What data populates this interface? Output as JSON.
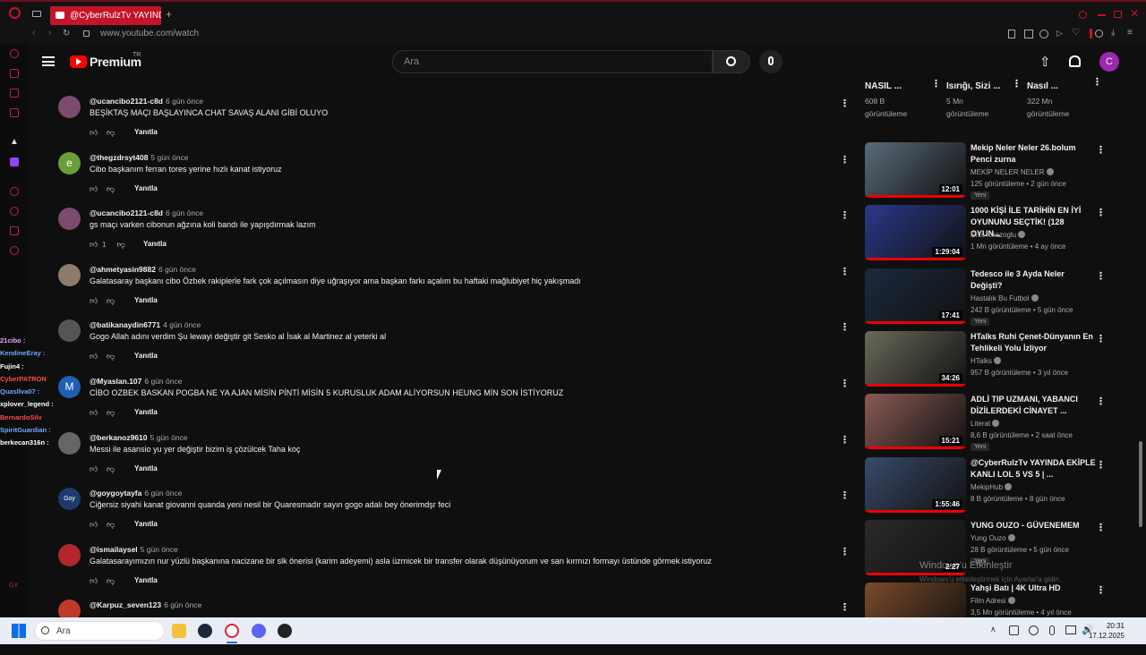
{
  "browser": {
    "tab_title": "@CyberRulzTv YAYINDA",
    "url": "www.youtube.com/watch",
    "new_tab": "+"
  },
  "header": {
    "logo": "Premium",
    "region": "TR",
    "search_placeholder": "Ara",
    "avatar_letter": "C"
  },
  "chat": [
    {
      "user": "21cibo :",
      "color": "#f0a0ff"
    },
    {
      "user": "KendineEray :",
      "color": "#6aa8ff"
    },
    {
      "user": "Fujin4 :",
      "color": "#ffffff"
    },
    {
      "user": "CyberPATRON",
      "color": "#ff4a4a"
    },
    {
      "user": "Quasllva07 :",
      "color": "#6aa8ff"
    },
    {
      "user": "xplover_legend :",
      "color": "#ffffff"
    },
    {
      "user": "BernardoSilv",
      "color": "#ff4a4a"
    },
    {
      "user": "SpiritGuardian :",
      "color": "#6aa8ff"
    },
    {
      "user": "berkecan316n :",
      "color": "#ffffff"
    }
  ],
  "comments": [
    {
      "user": "@ucancibo2121-c8d",
      "time": "6 gün önce",
      "text": "BEŞİKTAŞ MAÇI BAŞLAYINCA CHAT SAVAŞ ALANI GİBİ OLUYO",
      "likes": "",
      "reply": "Yanıtla",
      "avatar": "#7a4b6e",
      "letter": ""
    },
    {
      "user": "@thegzdrsyt408",
      "time": "5 gün önce",
      "text": "Cibo başkanım ferran tores yerine hızlı kanat istiyoruz",
      "likes": "",
      "reply": "Yanıtla",
      "avatar": "#689f38",
      "letter": "e"
    },
    {
      "user": "@ucancibo2121-c8d",
      "time": "6 gün önce",
      "text": "gs maçı varken cibonun ağzına koli bandı ile yapışdırmak lazım",
      "likes": "1",
      "reply": "Yanıtla",
      "avatar": "#7a4b6e",
      "letter": ""
    },
    {
      "user": "@ahmetyasin9882",
      "time": "6 gün önce",
      "text": "Galatasaray başkanı cibo Özbek rakiplerle fark çok açılmasın diye uğraşıyor ama başkan farkı açalım bu haftaki mağlubiyet hiç yakışmadı",
      "likes": "",
      "reply": "Yanıtla",
      "avatar": "#8d7b6a",
      "letter": ""
    },
    {
      "user": "@batikanaydin6771",
      "time": "4 gün önce",
      "text": "Gogo Allah adını verdim Şu lewayi değiştir git Sesko al İsak al Martinez al yeterki al",
      "likes": "",
      "reply": "Yanıtla",
      "avatar": "#555555",
      "letter": ""
    },
    {
      "user": "@Myaslan.107",
      "time": "6 gün önce",
      "text": "CİBO OZBEK BASKAN POGBA NE YA AJAN MİSİN PİNTİ MİSİN 5 KURUSLUK ADAM ALİYORSUN HEUNG MİN SON İSTİYORUZ",
      "likes": "",
      "reply": "Yanıtla",
      "avatar": "#1e5fb4",
      "letter": "M"
    },
    {
      "user": "@berkanoz9610",
      "time": "5 gün önce",
      "text": "Messi ile asansio yu yer değiştir bizim iş çözülcek Taha koç",
      "likes": "",
      "reply": "Yanıtla",
      "avatar": "#666666",
      "letter": ""
    },
    {
      "user": "@goygoytayfa",
      "time": "6 gün önce",
      "text": "Ciğersiz siyahi kanat giovanni quanda yeni nesil bir Quaresmadır sayın gogo adalı bey önerimdşr feci",
      "likes": "",
      "reply": "Yanıtla",
      "avatar": "#1c3a6e",
      "letter": "Goy"
    },
    {
      "user": "@ismailaysel",
      "time": "5 gün önce",
      "text": "Galatasarayımızın nur yüzlü başkanına nacizane bir slk önerisi (karim adeyemi) asla üzmicek bir transfer olarak düşünüyorum ve sarı kırmızı formayı üstünde görmek istiyoruz",
      "likes": "",
      "reply": "Yanıtla",
      "avatar": "#b3262e",
      "letter": ""
    },
    {
      "user": "@Karpuz_seven123",
      "time": "6 gün önce",
      "text": "",
      "likes": "",
      "reply": "",
      "avatar": "#c0392b",
      "letter": ""
    }
  ],
  "top_row": [
    {
      "title": "NASIL ...",
      "meta1": "608 B",
      "meta2": "görüntüleme"
    },
    {
      "title": "Isırığı, Sizi ...",
      "meta1": "5 Mn",
      "meta2": "görüntüleme"
    },
    {
      "title": "Nasıl ...",
      "meta1": "322 Mn",
      "meta2": "görüntüleme"
    }
  ],
  "related": [
    {
      "title": "Mekip Neler Neler 26.bolum Penci zurna",
      "channel": "MEKİP NELER NELER",
      "meta": "125 görüntüleme • 2 gün önce",
      "badge": "Yeni",
      "duration": "12:01",
      "bg": "#5a6b7a"
    },
    {
      "title": "1000 KİŞİ İLE TARİHİN EN İYİ OYUNUNU SEÇTİK! (128 OYUN...",
      "channel": "Enis Kirazoglu",
      "meta": "1 Mn görüntüleme • 4 ay önce",
      "badge": "",
      "duration": "1:29:04",
      "bg": "#2a3a8a"
    },
    {
      "title": "Tedesco ile 3 Ayda Neler Değişti?",
      "channel": "Hastalık Bu Futbol",
      "meta": "242 B görüntüleme • 5 gün önce",
      "badge": "Yeni",
      "duration": "17:41",
      "bg": "#1b2a3f"
    },
    {
      "title": "HTalks Ruhi Çenet-Dünyanın En Tehlikeli Yolu İzliyor",
      "channel": "HTalks",
      "meta": "957 B görüntüleme • 3 yıl önce",
      "badge": "",
      "duration": "34:26",
      "bg": "#6a6a5a"
    },
    {
      "title": "ADLİ TIP UZMANI, YABANCI DİZİLERDEKİ CİNAYET ...",
      "channel": "Literat",
      "meta": "8,6 B görüntüleme • 2 saat önce",
      "badge": "Yeni",
      "duration": "15:21",
      "bg": "#8a5a55"
    },
    {
      "title": "@CyberRulzTv YAYINDA EKİPLE KANLI LOL 5 VS 5 | ...",
      "channel": "MekipHub",
      "meta": "8 B görüntüleme • 8 gün önce",
      "badge": "",
      "duration": "1:55:46",
      "bg": "#3a4a6a"
    },
    {
      "title": "YUNG OUZO - GÜVENEMEM",
      "channel": "Yung Ouzo",
      "meta": "28 B görüntüleme • 5 gün önce",
      "badge": "Yeni",
      "duration": "2:27",
      "bg": "#2a2a2a"
    },
    {
      "title": "Yahşi Batı | 4K Ultra HD",
      "channel": "Film Adresi",
      "meta": "3,5 Mn görüntüleme • 4 yıl önce",
      "badge": "",
      "duration": "",
      "bg": "#7a4a2a"
    }
  ],
  "watermark": {
    "line1": "Windows'u Etkinleştir",
    "line2": "Windows'u etkinleştirmek için Ayarlar'a gidin."
  },
  "taskbar": {
    "search": "Ara",
    "time": "20:31",
    "date": "17.12.2025"
  },
  "colors": {
    "accent": "#c4142a",
    "avatar": "#9c27b0"
  }
}
